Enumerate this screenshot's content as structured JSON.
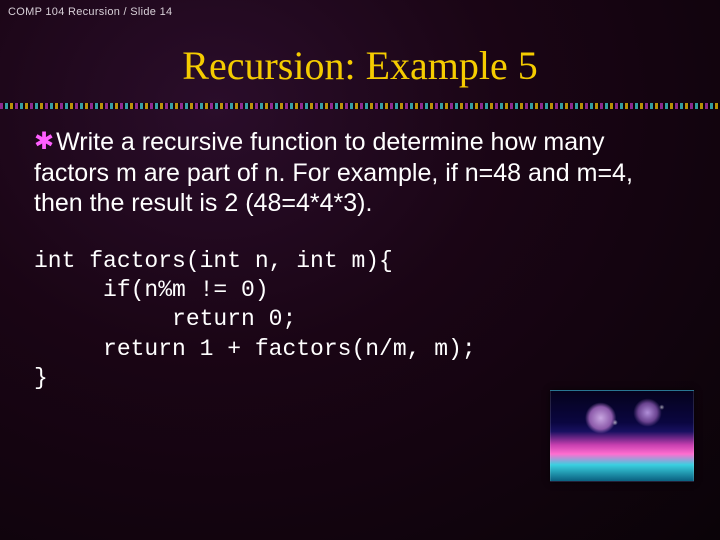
{
  "header": {
    "breadcrumb": "COMP 104 Recursion / Slide 14"
  },
  "title": "Recursion: Example 5",
  "bullet_glyph": "✱",
  "body": {
    "text": "Write a recursive function to determine how many factors m are part of n. For example, if n=48 and m=4, then the result is 2 (48=4*4*3)."
  },
  "code": "int factors(int n, int m){\n     if(n%m != 0)\n          return 0;\n     return 1 + factors(n/m, m);\n}",
  "decor": {
    "alt": "fractal-planets-illustration"
  }
}
